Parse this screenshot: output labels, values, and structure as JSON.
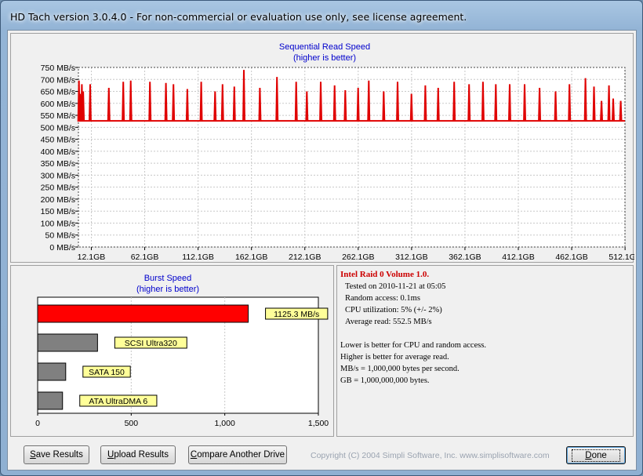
{
  "window": {
    "title": "HD Tach version 3.0.4.0  - For non-commercial or evaluation use only, see license agreement."
  },
  "sequential": {
    "title": "Sequential Read Speed",
    "subtitle": "(higher is better)"
  },
  "burst": {
    "title": "Burst Speed",
    "subtitle": "(higher is better)"
  },
  "chart_data": [
    {
      "type": "line",
      "title": "Sequential Read Speed",
      "subtitle": "(higher is better)",
      "ylim": [
        0,
        750
      ],
      "yticks": [
        0,
        50,
        100,
        150,
        200,
        250,
        300,
        350,
        400,
        450,
        500,
        550,
        600,
        650,
        700,
        750
      ],
      "y_unit": " MB/s",
      "xlim": [
        0,
        512
      ],
      "xticks": [
        12.1,
        62.1,
        112.1,
        162.1,
        212.1,
        262.1,
        312.1,
        362.1,
        412.1,
        462.1,
        512.1
      ],
      "xtick_labels": [
        "12.1GB",
        "62.1GB",
        "112.1GB",
        "162.1GB",
        "212.1GB",
        "262.1GB",
        "312.1GB",
        "362.1GB",
        "412.1GB",
        "462.1GB",
        "512.1GB"
      ],
      "grid": true,
      "color": "#e00000",
      "baseline": 527,
      "spikes": [
        {
          "x": 0.5,
          "y": 695
        },
        {
          "x": 1.5,
          "y": 640
        },
        {
          "x": 3.2,
          "y": 680
        },
        {
          "x": 4.5,
          "y": 650
        },
        {
          "x": 11,
          "y": 680
        },
        {
          "x": 28.5,
          "y": 665
        },
        {
          "x": 42,
          "y": 690
        },
        {
          "x": 49,
          "y": 695
        },
        {
          "x": 67,
          "y": 690
        },
        {
          "x": 82,
          "y": 685
        },
        {
          "x": 89,
          "y": 680
        },
        {
          "x": 102,
          "y": 660
        },
        {
          "x": 115,
          "y": 690
        },
        {
          "x": 128,
          "y": 650
        },
        {
          "x": 135,
          "y": 680
        },
        {
          "x": 146,
          "y": 670
        },
        {
          "x": 155,
          "y": 740
        },
        {
          "x": 170,
          "y": 665
        },
        {
          "x": 186,
          "y": 710
        },
        {
          "x": 204,
          "y": 690
        },
        {
          "x": 214,
          "y": 650
        },
        {
          "x": 227,
          "y": 690
        },
        {
          "x": 240,
          "y": 675
        },
        {
          "x": 250,
          "y": 655
        },
        {
          "x": 262,
          "y": 665
        },
        {
          "x": 272,
          "y": 695
        },
        {
          "x": 286,
          "y": 650
        },
        {
          "x": 299,
          "y": 690
        },
        {
          "x": 312,
          "y": 640
        },
        {
          "x": 325,
          "y": 675
        },
        {
          "x": 337,
          "y": 665
        },
        {
          "x": 352,
          "y": 690
        },
        {
          "x": 366,
          "y": 680
        },
        {
          "x": 379,
          "y": 690
        },
        {
          "x": 391,
          "y": 680
        },
        {
          "x": 404,
          "y": 680
        },
        {
          "x": 418,
          "y": 680
        },
        {
          "x": 432,
          "y": 665
        },
        {
          "x": 447,
          "y": 650
        },
        {
          "x": 460,
          "y": 680
        },
        {
          "x": 475,
          "y": 705
        },
        {
          "x": 483,
          "y": 670
        },
        {
          "x": 490,
          "y": 610
        },
        {
          "x": 501,
          "y": 620
        },
        {
          "x": 508,
          "y": 610
        },
        {
          "x": 497,
          "y": 675
        }
      ]
    },
    {
      "type": "bar",
      "orientation": "horizontal",
      "title": "Burst Speed",
      "subtitle": "(higher is better)",
      "xlim": [
        0,
        1500
      ],
      "xticks": [
        0,
        500,
        1000,
        1500
      ],
      "xtick_labels": [
        "0",
        "500",
        "1,000",
        "1,500"
      ],
      "grid": true,
      "bars": [
        {
          "label": "1125.3 MB/s",
          "value": 1125.3,
          "color": "#ff0000"
        },
        {
          "label": "SCSI Ultra320",
          "value": 320,
          "color": "#808080"
        },
        {
          "label": "SATA 150",
          "value": 150,
          "color": "#808080"
        },
        {
          "label": "ATA UltraDMA 6",
          "value": 133,
          "color": "#808080"
        }
      ]
    }
  ],
  "info": {
    "title": "Intel Raid 0 Volume 1.0.",
    "tested": "Tested on 2010-11-21 at 05:05",
    "random_access": "Random access: 0.1ms",
    "cpu": "CPU utilization: 5% (+/- 2%)",
    "average_read": "Average read: 552.5 MB/s",
    "note1": "Lower is better for CPU and random access.",
    "note2": "Higher is better for average read.",
    "note3": "MB/s = 1,000,000 bytes per second.",
    "note4": "GB = 1,000,000,000 bytes."
  },
  "buttons": {
    "save_u": "S",
    "save_rest": "ave Results",
    "upload_u": "U",
    "upload_rest": "pload Results",
    "compare_u": "C",
    "compare_rest": "ompare Another Drive",
    "done_u": "D",
    "done_rest": "one"
  },
  "copyright": "Copyright (C) 2004 Simpli Software, Inc. www.simplisoftware.com"
}
